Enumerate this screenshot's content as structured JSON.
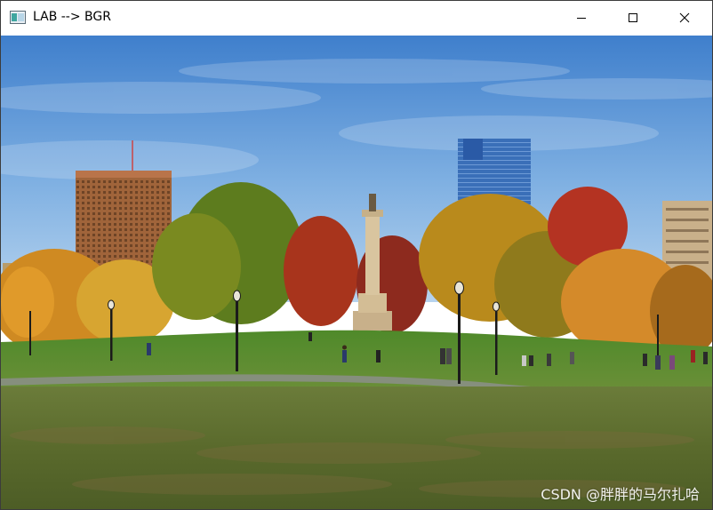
{
  "window": {
    "title": "LAB --> BGR",
    "icon": "opencv-window-icon",
    "controls": {
      "minimize_icon": "minimize-icon",
      "maximize_icon": "maximize-icon",
      "close_icon": "close-icon"
    }
  },
  "image": {
    "subject": "autumn park with monument, trees and city buildings",
    "watermark": "CSDN @胖胖的马尔扎哈"
  },
  "colors": {
    "sky_top": "#4a86cf",
    "sky_bottom": "#9cc4ea",
    "grass": "#4f7a2a",
    "foliage_orange": "#d88a1e",
    "foliage_red": "#a8321c",
    "foliage_green": "#5f7f1e"
  }
}
